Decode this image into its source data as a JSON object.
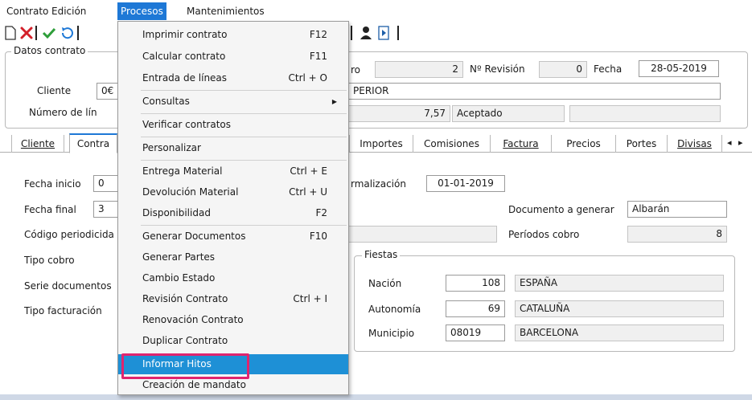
{
  "menubar": {
    "items": [
      {
        "label": "Contrato"
      },
      {
        "label": "Edición"
      },
      {
        "label": "Procesos"
      },
      {
        "label": "Mantenimientos"
      }
    ]
  },
  "icons": {
    "new": "new-document-icon",
    "delete": "delete-icon",
    "confirm": "check-icon",
    "undo": "undo-icon",
    "user": "user-icon",
    "export": "export-icon"
  },
  "colors": {
    "menu_active": "#1e78d6",
    "menu_highlight": "#1e90d6",
    "focus_box": "#e0246e"
  },
  "datos": {
    "title": "Datos contrato",
    "cliente_label": "Cliente",
    "cliente_value": "0€",
    "numero_label": "Número de lín",
    "numero_suffix": "ro",
    "numero_value": "2",
    "revision_label": "Nº Revisión",
    "revision_value": "0",
    "fecha_label": "Fecha",
    "fecha_value": "28-05-2019",
    "desc_value": "PERIOR",
    "importe_value": "7,57",
    "estado_value": "Aceptado"
  },
  "tabs": [
    {
      "label": "Cliente"
    },
    {
      "label": "Contra"
    },
    {
      "label": "Importes"
    },
    {
      "label": "Comisiones"
    },
    {
      "label": "Factura"
    },
    {
      "label": "Precios"
    },
    {
      "label": "Portes"
    },
    {
      "label": "Divisas"
    }
  ],
  "tab_nav": {
    "prev": "◂",
    "next": "▸"
  },
  "form": {
    "fecha_inicio_label": "Fecha inicio",
    "fecha_inicio_value": "0",
    "fecha_final_label": "Fecha final",
    "fecha_final_value": "3",
    "codigo_label": "Código periodicida",
    "tipo_cobro_label": "Tipo cobro",
    "serie_label": "Serie documentos",
    "tipo_fact_label": "Tipo facturación",
    "formalizacion_label": "rmalización",
    "formalizacion_value": "01-01-2019",
    "doc_generar_label": "Documento a generar",
    "doc_generar_value": "Albarán",
    "periodos_label": "Períodos cobro",
    "periodos_value": "8"
  },
  "fiestas": {
    "title": "Fiestas",
    "rows": [
      {
        "label": "Nación",
        "code": "108",
        "name": "ESPAÑA"
      },
      {
        "label": "Autonomía",
        "code": "69",
        "name": "CATALUÑA"
      },
      {
        "label": "Municipio",
        "code": "08019",
        "name": "BARCELONA"
      }
    ]
  },
  "dropdown": {
    "items": [
      {
        "label": "Imprimir contrato",
        "shortcut": "F12"
      },
      {
        "label": "Calcular contrato",
        "shortcut": "F11"
      },
      {
        "label": "Entrada de líneas",
        "shortcut": "Ctrl + O"
      },
      {
        "label": "Consultas",
        "shortcut": ""
      },
      {
        "label": "Verificar contratos",
        "shortcut": ""
      },
      {
        "label": "Personalizar",
        "shortcut": ""
      },
      {
        "label": "Entrega Material",
        "shortcut": "Ctrl + E"
      },
      {
        "label": "Devolución Material",
        "shortcut": "Ctrl + U"
      },
      {
        "label": "Disponibilidad",
        "shortcut": "F2"
      },
      {
        "label": "Generar Documentos",
        "shortcut": "F10"
      },
      {
        "label": "Generar Partes",
        "shortcut": ""
      },
      {
        "label": "Cambio Estado",
        "shortcut": ""
      },
      {
        "label": "Revisión Contrato",
        "shortcut": "Ctrl + I"
      },
      {
        "label": "Renovación Contrato",
        "shortcut": ""
      },
      {
        "label": "Duplicar Contrato",
        "shortcut": ""
      },
      {
        "label": "Informar Hitos",
        "shortcut": ""
      },
      {
        "label": "Creación de mandato",
        "shortcut": ""
      }
    ],
    "submenu_arrow": "▶"
  }
}
